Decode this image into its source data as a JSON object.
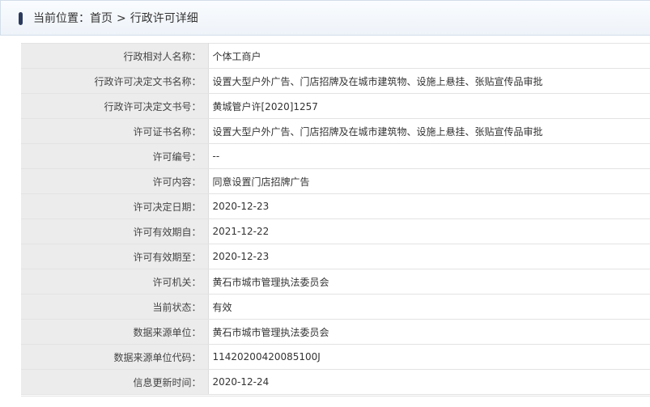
{
  "breadcrumb": {
    "prefix": "当前位置：",
    "home": "首页",
    "separator": ">",
    "current": "行政许可详细"
  },
  "rows": [
    {
      "label": "行政相对人名称：",
      "value": "个体工商户"
    },
    {
      "label": "行政许可决定文书名称：",
      "value": "设置大型户外广告、门店招牌及在城市建筑物、设施上悬挂、张贴宣传品审批"
    },
    {
      "label": "行政许可决定文书号：",
      "value": "黄城管户许[2020]1257"
    },
    {
      "label": "许可证书名称：",
      "value": "设置大型户外广告、门店招牌及在城市建筑物、设施上悬挂、张贴宣传品审批"
    },
    {
      "label": "许可编号：",
      "value": "--"
    },
    {
      "label": "许可内容：",
      "value": "同意设置门店招牌广告"
    },
    {
      "label": "许可决定日期：",
      "value": "2020-12-23"
    },
    {
      "label": "许可有效期自：",
      "value": "2021-12-22"
    },
    {
      "label": "许可有效期至：",
      "value": "2020-12-23"
    },
    {
      "label": "许可机关：",
      "value": "黄石市城市管理执法委员会"
    },
    {
      "label": "当前状态：",
      "value": "有效"
    },
    {
      "label": "数据来源单位：",
      "value": "黄石市城市管理执法委员会"
    },
    {
      "label": "数据来源单位代码：",
      "value": "11420200420085100J"
    },
    {
      "label": "信息更新时间：",
      "value": "2020-12-24"
    }
  ]
}
